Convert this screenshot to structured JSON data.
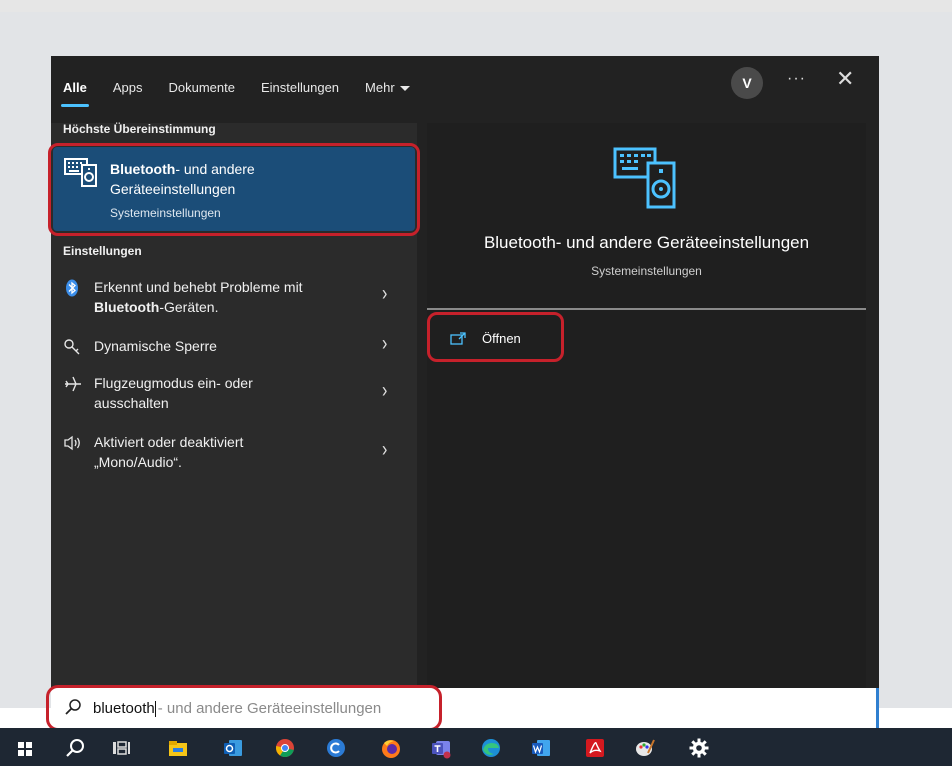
{
  "tabs": [
    {
      "label": "Alle",
      "active": true
    },
    {
      "label": "Apps"
    },
    {
      "label": "Dokumente"
    },
    {
      "label": "Einstellungen"
    },
    {
      "label": "Mehr"
    }
  ],
  "header": {
    "avatar": "V",
    "more": "···",
    "close": "✕"
  },
  "best_match": {
    "section_title": "Höchste Übereinstimmung",
    "title_bold": "Bluetooth",
    "title_rest": "- und andere Geräteeinstellungen",
    "subtitle": "Systemeinstellungen",
    "icon": "bluetooth-devices-icon"
  },
  "settings": {
    "section_title": "Einstellungen",
    "items": [
      {
        "icon": "bluetooth-icon",
        "line1": "Erkennt und behebt Probleme mit",
        "bold": "Bluetooth",
        "rest": "-Geräten."
      },
      {
        "icon": "key-icon",
        "text": "Dynamische Sperre"
      },
      {
        "icon": "airplane-icon",
        "line1": "Flugzeugmodus ein- oder",
        "line2": "ausschalten"
      },
      {
        "icon": "speaker-icon",
        "line1": "Aktiviert oder deaktiviert",
        "line2": "„Mono/Audio“."
      }
    ],
    "chevron": "›"
  },
  "detail": {
    "title": "Bluetooth- und andere Geräteeinstellungen",
    "subtitle": "Systemeinstellungen",
    "open_label": "Öffnen"
  },
  "search": {
    "typed": "bluetooth",
    "hint": "- und andere Geräteeinstellungen"
  },
  "taskbar": [
    "windows-start-icon",
    "search-icon",
    "task-view-icon",
    "file-explorer-icon",
    "outlook-icon",
    "chrome-icon",
    "browser-icon",
    "firefox-icon",
    "teams-icon",
    "edge-icon",
    "word-icon",
    "acrobat-icon",
    "paint-icon",
    "settings-gear-icon"
  ],
  "colors": {
    "accent": "#4cc2ff",
    "selection": "#1b4d78",
    "highlight": "#c6212b"
  }
}
